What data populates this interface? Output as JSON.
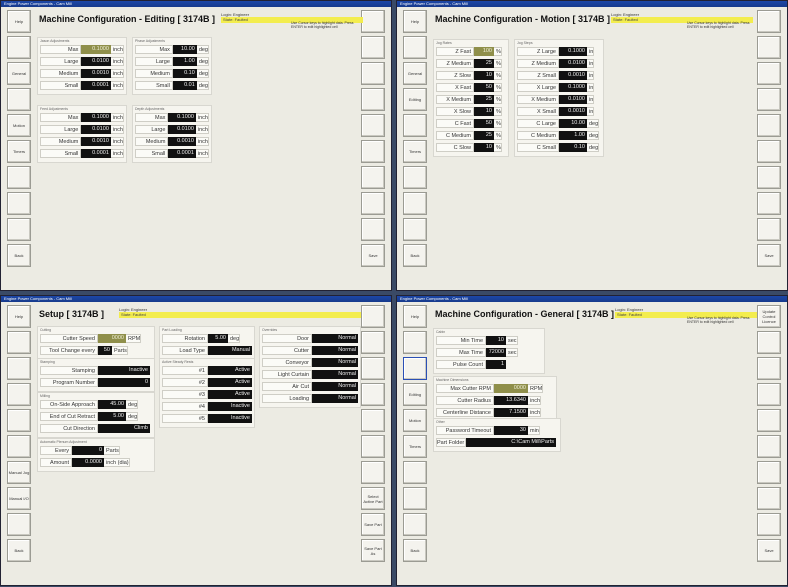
{
  "windows": [
    {
      "title_bar": "Engine Power Components - Cam Mill",
      "heading": "Machine Configuration - Editing   [ 3174B ]",
      "login_label": "Login: Engineer",
      "state": "State: Faulted",
      "hint": "Use Cursor keys to highlight data. Press ENTER to edit highlighted cell",
      "left_buttons": [
        "Help",
        "",
        "General",
        "",
        "Motion",
        "Timers",
        "",
        "",
        "",
        "Back"
      ],
      "right_buttons": [
        "",
        "",
        "",
        "",
        "",
        "",
        "",
        "",
        "",
        "Save"
      ],
      "panels": [
        {
          "title": "Jason Adjustments",
          "rows": [
            {
              "label": "Max",
              "value": "0.1000",
              "unit": "inch",
              "selected": true
            },
            {
              "label": "Large",
              "value": "0.0100",
              "unit": "inch"
            },
            {
              "label": "Medium",
              "value": "0.0010",
              "unit": "inch"
            },
            {
              "label": "Small",
              "value": "0.0001",
              "unit": "inch"
            }
          ]
        },
        {
          "title": "Phase Adjustments",
          "rows": [
            {
              "label": "Max",
              "value": "10.00",
              "unit": "deg"
            },
            {
              "label": "Large",
              "value": "1.00",
              "unit": "deg"
            },
            {
              "label": "Medium",
              "value": "0.10",
              "unit": "deg"
            },
            {
              "label": "Small",
              "value": "0.01",
              "unit": "deg"
            }
          ]
        },
        {
          "title": "Feed Adjustments",
          "rows": [
            {
              "label": "Max",
              "value": "0.1000",
              "unit": "inch"
            },
            {
              "label": "Large",
              "value": "0.0100",
              "unit": "inch"
            },
            {
              "label": "Medium",
              "value": "0.0010",
              "unit": "inch"
            },
            {
              "label": "Small",
              "value": "0.0001",
              "unit": "inch"
            }
          ]
        },
        {
          "title": "Depth Adjustments",
          "rows": [
            {
              "label": "Max",
              "value": "0.1000",
              "unit": "inch"
            },
            {
              "label": "Large",
              "value": "0.0100",
              "unit": "inch"
            },
            {
              "label": "Medium",
              "value": "0.0010",
              "unit": "inch"
            },
            {
              "label": "Small",
              "value": "0.0001",
              "unit": "inch"
            }
          ]
        }
      ]
    },
    {
      "title_bar": "Engine Power Components - Cam Mill",
      "heading": "Machine Configuration - Motion   [ 3174B ]",
      "login_label": "Login: Engineer",
      "state": "State: Faulted",
      "hint": "Use Cursor keys to highlight data. Press ENTER to edit highlighted cell",
      "left_buttons": [
        "Help",
        "",
        "General",
        "Editing",
        "",
        "Timers",
        "",
        "",
        "",
        "Back"
      ],
      "right_buttons": [
        "",
        "",
        "",
        "",
        "",
        "",
        "",
        "",
        "",
        "Save"
      ],
      "panels": [
        {
          "title": "Jog Rates",
          "rows": [
            {
              "label": "Z Fast",
              "value": "100",
              "unit": "%",
              "selected": true
            },
            {
              "label": "Z Medium",
              "value": "25",
              "unit": "%"
            },
            {
              "label": "Z Slow",
              "value": "10",
              "unit": "%"
            },
            {
              "label": "X Fast",
              "value": "50",
              "unit": "%"
            },
            {
              "label": "X Medium",
              "value": "25",
              "unit": "%"
            },
            {
              "label": "X Slow",
              "value": "10",
              "unit": "%"
            },
            {
              "label": "C Fast",
              "value": "50",
              "unit": "%"
            },
            {
              "label": "C Medium",
              "value": "25",
              "unit": "%"
            },
            {
              "label": "C Slow",
              "value": "10",
              "unit": "%"
            }
          ]
        },
        {
          "title": "Jog Steps",
          "rows": [
            {
              "label": "Z Large",
              "value": "0.1000",
              "unit": "in"
            },
            {
              "label": "Z Medium",
              "value": "0.0100",
              "unit": "in"
            },
            {
              "label": "Z Small",
              "value": "0.0010",
              "unit": "in"
            },
            {
              "label": "X Large",
              "value": "0.1000",
              "unit": "in"
            },
            {
              "label": "X Medium",
              "value": "0.0100",
              "unit": "in"
            },
            {
              "label": "X Small",
              "value": "0.0010",
              "unit": "in"
            },
            {
              "label": "C Large",
              "value": "10.00",
              "unit": "deg"
            },
            {
              "label": "C Medium",
              "value": "1.00",
              "unit": "deg"
            },
            {
              "label": "C Small",
              "value": "0.10",
              "unit": "deg"
            }
          ]
        }
      ]
    },
    {
      "title_bar": "Engine Power Components - Cam Mill",
      "heading": "Setup  [ 3174B ]",
      "login_label": "Login: Engineer",
      "state": "State: Faulted",
      "left_buttons": [
        "Help",
        "",
        "",
        "",
        "",
        "",
        "Manual Jog",
        "Manual I/O",
        "",
        "Back"
      ],
      "right_buttons": [
        "",
        "",
        "",
        "",
        "",
        "",
        "",
        "Select Active Part",
        "Save Part",
        "Save Part As"
      ],
      "panels": [
        {
          "title": "Cutting",
          "rows": [
            {
              "label": "Cutter Speed",
              "value": "0000",
              "unit": "RPM",
              "selected": true
            },
            {
              "label": "Tool Change every",
              "value": "50",
              "unit": "Parts"
            }
          ]
        },
        {
          "title": "Stamping",
          "rows": [
            {
              "label": "Stamping",
              "value": "Inactive",
              "unit": ""
            },
            {
              "label": "Program Number",
              "value": "0",
              "unit": ""
            }
          ]
        },
        {
          "title": "Milling",
          "rows": [
            {
              "label": "On-Side Approach",
              "value": "45.00",
              "unit": "deg"
            },
            {
              "label": "End of Cut Retract",
              "value": "5.00",
              "unit": "deg"
            },
            {
              "label": "Cut Direction",
              "value": "Climb",
              "unit": ""
            }
          ]
        },
        {
          "title": "Automatic Plenum Adjustment",
          "rows": [
            {
              "label": "Every",
              "value": "0",
              "unit": "Parts"
            },
            {
              "label": "Amount",
              "value": "0.0000",
              "unit": "inch (dia)"
            }
          ]
        },
        {
          "title": "Part Loading",
          "rows": [
            {
              "label": "Rotation",
              "value": "5.00",
              "unit": "deg"
            },
            {
              "label": "Load Type",
              "value": "Manual",
              "unit": ""
            }
          ]
        },
        {
          "title": "Active Steady Rests",
          "rows": [
            {
              "label": "#1",
              "value": "Active",
              "unit": ""
            },
            {
              "label": "#2",
              "value": "Active",
              "unit": ""
            },
            {
              "label": "#3",
              "value": "Active",
              "unit": ""
            },
            {
              "label": "#4",
              "value": "Inactive",
              "unit": ""
            },
            {
              "label": "#5",
              "value": "Inactive",
              "unit": ""
            }
          ]
        },
        {
          "title": "Overrides",
          "rows": [
            {
              "label": "Door",
              "value": "Normal",
              "unit": ""
            },
            {
              "label": "Cutter",
              "value": "Normal",
              "unit": ""
            },
            {
              "label": "Conveyor",
              "value": "Normal",
              "unit": ""
            },
            {
              "label": "Light Curtain",
              "value": "Normal",
              "unit": ""
            },
            {
              "label": "Air Cut",
              "value": "Normal",
              "unit": ""
            },
            {
              "label": "Loading",
              "value": "Normal",
              "unit": ""
            }
          ]
        }
      ]
    },
    {
      "title_bar": "Engine Power Components - Cam Mill",
      "heading": "Machine Configuration - General   [ 3174B ]",
      "login_label": "Login: Engineer",
      "state": "State: Faulted",
      "hint": "Use Cursor keys to highlight data. Press ENTER to edit highlighted cell",
      "left_buttons": [
        "Help",
        "",
        "",
        "Editing",
        "Motion",
        "Timers",
        "",
        "",
        "",
        "Back"
      ],
      "right_buttons": [
        "Update Control Licence",
        "",
        "",
        "",
        "",
        "",
        "",
        "",
        "",
        "Save"
      ],
      "panels": [
        {
          "title": "Cabin",
          "rows": [
            {
              "label": "Min Time",
              "value": "10",
              "unit": "sec"
            },
            {
              "label": "Max Time",
              "value": "72000",
              "unit": "sec"
            },
            {
              "label": "Pulse Count",
              "value": "1",
              "unit": ""
            }
          ]
        },
        {
          "title": "Machine Dimensions",
          "rows": [
            {
              "label": "Max Cutter RPM",
              "value": "0000",
              "unit": "RPM",
              "selected": true
            },
            {
              "label": "Cutter Radius",
              "value": "13.6340",
              "unit": "inch"
            },
            {
              "label": "Centerline Distance",
              "value": "7.1500",
              "unit": "inch"
            }
          ]
        },
        {
          "title": "Other",
          "rows": [
            {
              "label": "Password Timeout",
              "value": "30",
              "unit": "min"
            },
            {
              "label": "Part Folder",
              "value": "C:\\Cam Mill\\Parts",
              "unit": ""
            }
          ]
        }
      ]
    }
  ]
}
